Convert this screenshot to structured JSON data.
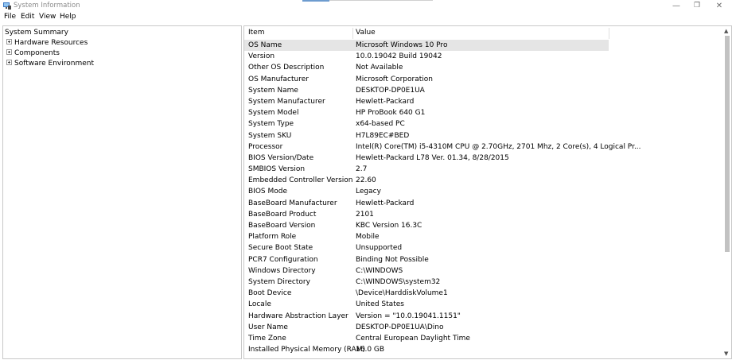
{
  "window": {
    "title": "System Information",
    "minimize_glyph": "—",
    "maximize_glyph": "❐",
    "close_glyph": "✕"
  },
  "menu": [
    "File",
    "Edit",
    "View",
    "Help"
  ],
  "tree": {
    "root": "System Summary",
    "children": [
      "Hardware Resources",
      "Components",
      "Software Environment"
    ]
  },
  "table": {
    "headers": {
      "item": "Item",
      "value": "Value"
    },
    "rows": [
      {
        "item": "OS Name",
        "value": "Microsoft Windows 10 Pro"
      },
      {
        "item": "Version",
        "value": "10.0.19042 Build 19042"
      },
      {
        "item": "Other OS Description",
        "value": "Not Available"
      },
      {
        "item": "OS Manufacturer",
        "value": "Microsoft Corporation"
      },
      {
        "item": "System Name",
        "value": "DESKTOP-DP0E1UA"
      },
      {
        "item": "System Manufacturer",
        "value": "Hewlett-Packard"
      },
      {
        "item": "System Model",
        "value": "HP ProBook 640 G1"
      },
      {
        "item": "System Type",
        "value": "x64-based PC"
      },
      {
        "item": "System SKU",
        "value": "H7L89EC#BED"
      },
      {
        "item": "Processor",
        "value": "Intel(R) Core(TM) i5-4310M CPU @ 2.70GHz, 2701 Mhz, 2 Core(s), 4 Logical Pr..."
      },
      {
        "item": "BIOS Version/Date",
        "value": "Hewlett-Packard L78 Ver. 01.34, 8/28/2015"
      },
      {
        "item": "SMBIOS Version",
        "value": "2.7"
      },
      {
        "item": "Embedded Controller Version",
        "value": "22.60"
      },
      {
        "item": "BIOS Mode",
        "value": "Legacy"
      },
      {
        "item": "BaseBoard Manufacturer",
        "value": "Hewlett-Packard"
      },
      {
        "item": "BaseBoard Product",
        "value": "2101"
      },
      {
        "item": "BaseBoard Version",
        "value": "KBC Version 16.3C"
      },
      {
        "item": "Platform Role",
        "value": "Mobile"
      },
      {
        "item": "Secure Boot State",
        "value": "Unsupported"
      },
      {
        "item": "PCR7 Configuration",
        "value": "Binding Not Possible"
      },
      {
        "item": "Windows Directory",
        "value": "C:\\WINDOWS"
      },
      {
        "item": "System Directory",
        "value": "C:\\WINDOWS\\system32"
      },
      {
        "item": "Boot Device",
        "value": "\\Device\\HarddiskVolume1"
      },
      {
        "item": "Locale",
        "value": "United States"
      },
      {
        "item": "Hardware Abstraction Layer",
        "value": "Version = \"10.0.19041.1151\""
      },
      {
        "item": "User Name",
        "value": "DESKTOP-DP0E1UA\\Dino"
      },
      {
        "item": "Time Zone",
        "value": "Central European Daylight Time"
      },
      {
        "item": "Installed Physical Memory (RAM)",
        "value": "16.0 GB"
      }
    ]
  },
  "icons": {
    "app": "system-information-icon",
    "expander": "plus-box-icon",
    "scroll_up": "chevron-up-icon",
    "scroll_down": "chevron-down-icon"
  },
  "colors": {
    "selected_row": "#e5e5e5",
    "pane_border": "#c8c8c8",
    "title_text": "#8a8a8a"
  }
}
